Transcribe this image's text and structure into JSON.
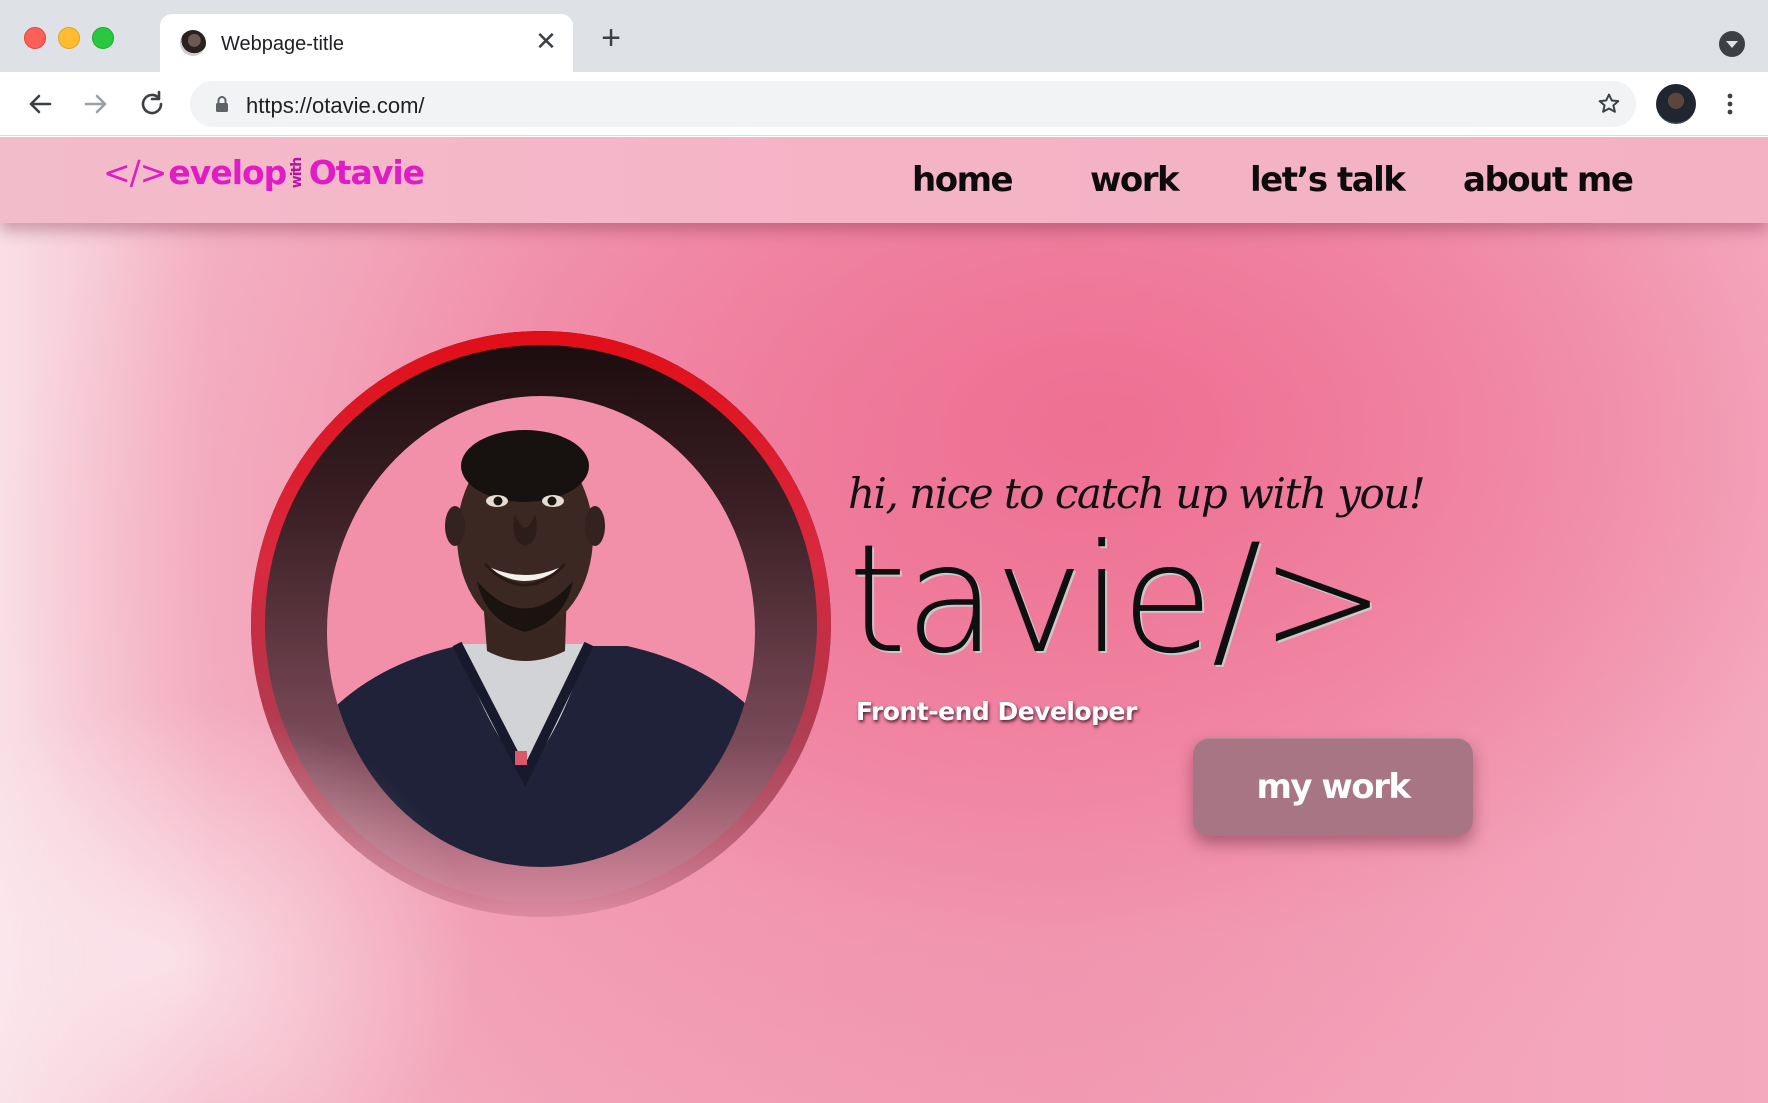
{
  "browser": {
    "tab_title": "Webpage-title",
    "tab_close": "✕",
    "new_tab": "+",
    "url": "https://otavie.com/"
  },
  "site": {
    "logo": {
      "brackets": "</>",
      "text_a": "evelop",
      "with": "with",
      "text_b": "Otavie",
      "color": "#e01cc4"
    },
    "nav": {
      "home": "home",
      "work": "work",
      "talk": "let’s talk",
      "about": "about me"
    }
  },
  "hero": {
    "greeting": "hi, nice to catch up with you!",
    "name": "tavie/>",
    "role": "Front-end Developer",
    "cta_label": "my work",
    "ring_color": "#e10e17"
  }
}
